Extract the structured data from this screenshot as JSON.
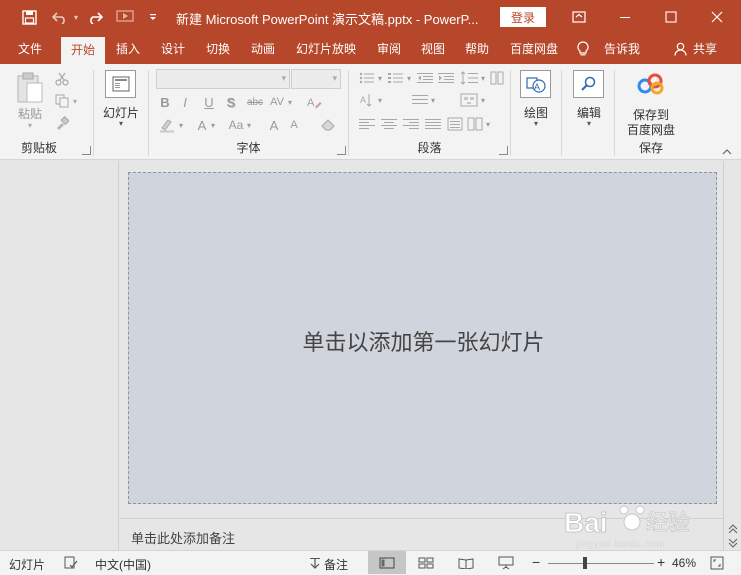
{
  "titlebar": {
    "title": "新建 Microsoft PowerPoint 演示文稿.pptx  -  PowerP...",
    "login_label": "登录",
    "icons": [
      "save-icon",
      "undo-icon",
      "redo-icon",
      "start-from-beginning-icon",
      "customize-qat-icon"
    ],
    "window_controls": [
      "ribbon-display-options-icon",
      "minimize-icon",
      "maximize-icon",
      "close-icon"
    ]
  },
  "tabs": [
    {
      "label": "文件"
    },
    {
      "label": "开始",
      "active": true
    },
    {
      "label": "插入"
    },
    {
      "label": "设计"
    },
    {
      "label": "切换"
    },
    {
      "label": "动画"
    },
    {
      "label": "幻灯片放映"
    },
    {
      "label": "审阅"
    },
    {
      "label": "视图"
    },
    {
      "label": "帮助"
    },
    {
      "label": "百度网盘"
    },
    {
      "label": "告诉我"
    },
    {
      "label": "共享"
    }
  ],
  "ribbon": {
    "clipboard": {
      "label": "剪贴板",
      "paste_label": "粘贴"
    },
    "slides": {
      "new_slide_label": "幻灯片"
    },
    "font": {
      "label": "字体",
      "buttons": [
        "B",
        "I",
        "U",
        "S",
        "abc",
        "AV",
        "A",
        "Aa",
        "A",
        "A"
      ]
    },
    "paragraph": {
      "label": "段落"
    },
    "drawing": {
      "label": "绘图"
    },
    "editing": {
      "label": "编辑"
    },
    "save": {
      "label": "保存",
      "button_line1": "保存到",
      "button_line2": "百度网盘"
    }
  },
  "slide": {
    "placeholder": "单击以添加第一张幻灯片"
  },
  "notes": {
    "placeholder": "单击此处添加备注"
  },
  "statusbar": {
    "slide_label": "幻灯片",
    "language": "中文(中国)",
    "notes_label": "备注",
    "zoom_minus": "−",
    "zoom_plus": "+",
    "zoom": "46%",
    "zoom_fraction": 0.35
  },
  "watermark": {
    "line1": "Bai百经验",
    "line2": "jingyan.baidu.com"
  },
  "colors": {
    "accent": "#b7472a",
    "ribbon_bg": "#f3f3f3",
    "workspace_bg": "#e6e6e6",
    "slide_bg": "#d0d4dc"
  }
}
